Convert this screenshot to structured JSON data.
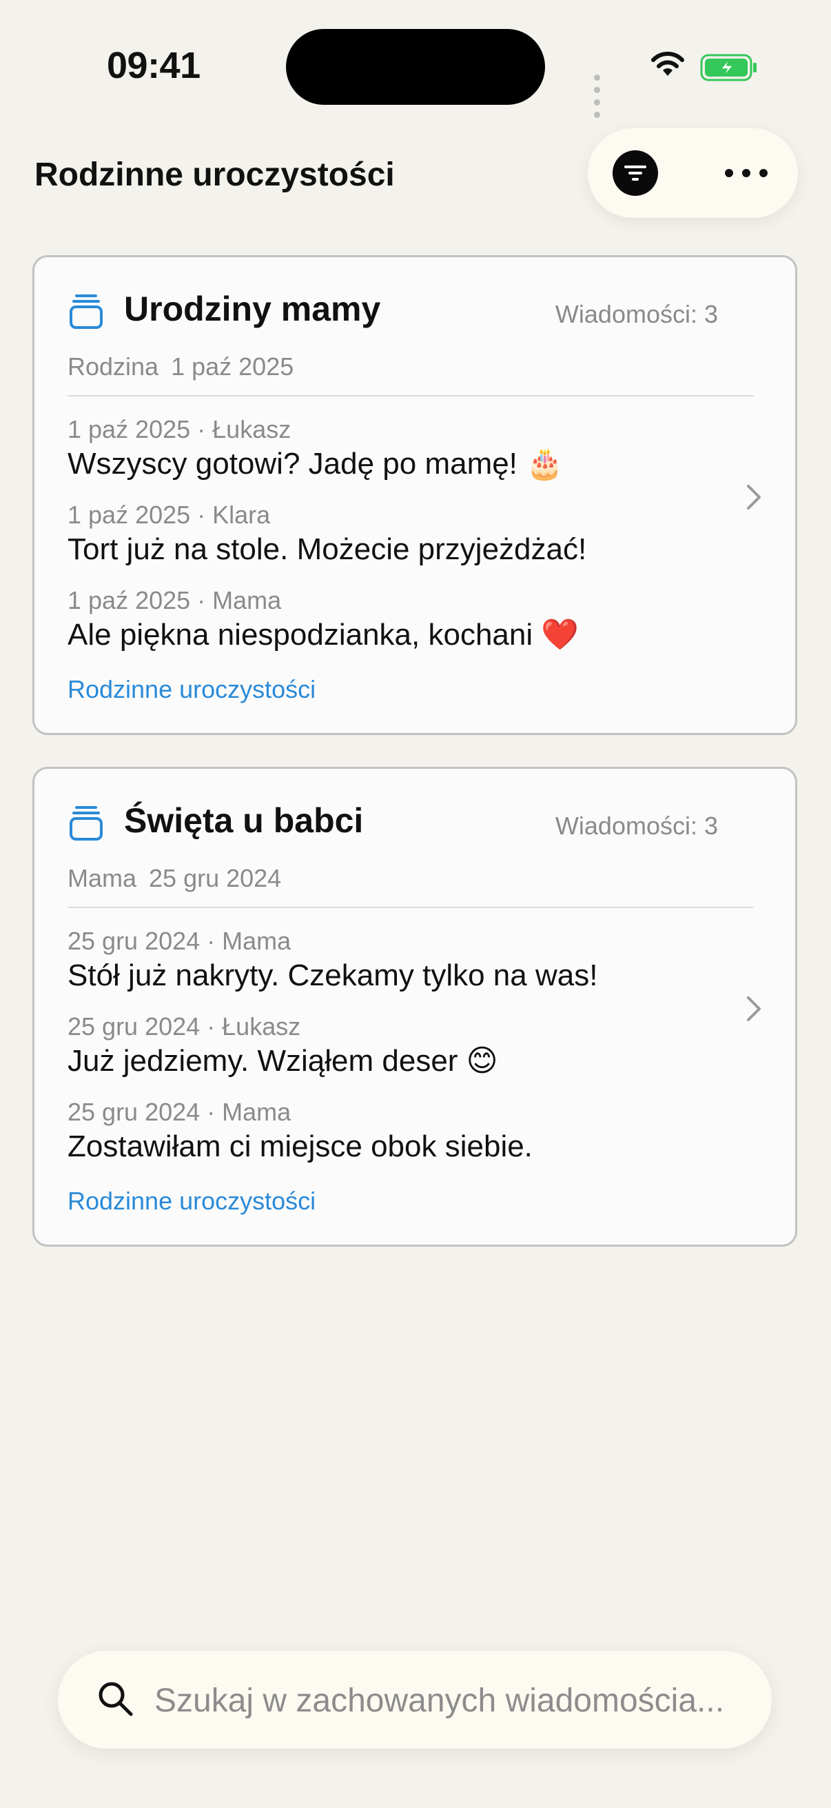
{
  "status_bar": {
    "time": "09:41"
  },
  "header": {
    "title": "Rodzinne uroczystości"
  },
  "cards": [
    {
      "title": "Urodziny mamy",
      "count": "Wiadomości: 3",
      "author": "Rodzina",
      "date": "1 paź 2025",
      "messages": [
        {
          "meta": "1 paź 2025 · Łukasz",
          "text": "Wszyscy gotowi? Jadę po mamę! 🎂"
        },
        {
          "meta": "1 paź 2025 · Klara",
          "text": "Tort już na stole. Możecie przyjeżdżać!"
        },
        {
          "meta": "1 paź 2025 · Mama",
          "text": "Ale piękna niespodzianka, kochani ❤️"
        }
      ],
      "link": "Rodzinne uroczystości"
    },
    {
      "title": "Święta u babci",
      "count": "Wiadomości: 3",
      "author": "Mama",
      "date": "25 gru 2024",
      "messages": [
        {
          "meta": "25 gru 2024 · Mama",
          "text": "Stół już nakryty. Czekamy tylko na was!"
        },
        {
          "meta": "25 gru 2024 · Łukasz",
          "text": "Już jedziemy. Wziąłem deser 😊"
        },
        {
          "meta": "25 gru 2024 · Mama",
          "text": "Zostawiłam ci miejsce obok siebie."
        }
      ],
      "link": "Rodzinne uroczystości"
    }
  ],
  "search": {
    "placeholder": "Szukaj w zachowanych wiadomościa..."
  },
  "colors": {
    "accent": "#2a8ad8",
    "background": "#f4f2ec",
    "card": "#fbfbfb",
    "battery": "#34c759"
  }
}
